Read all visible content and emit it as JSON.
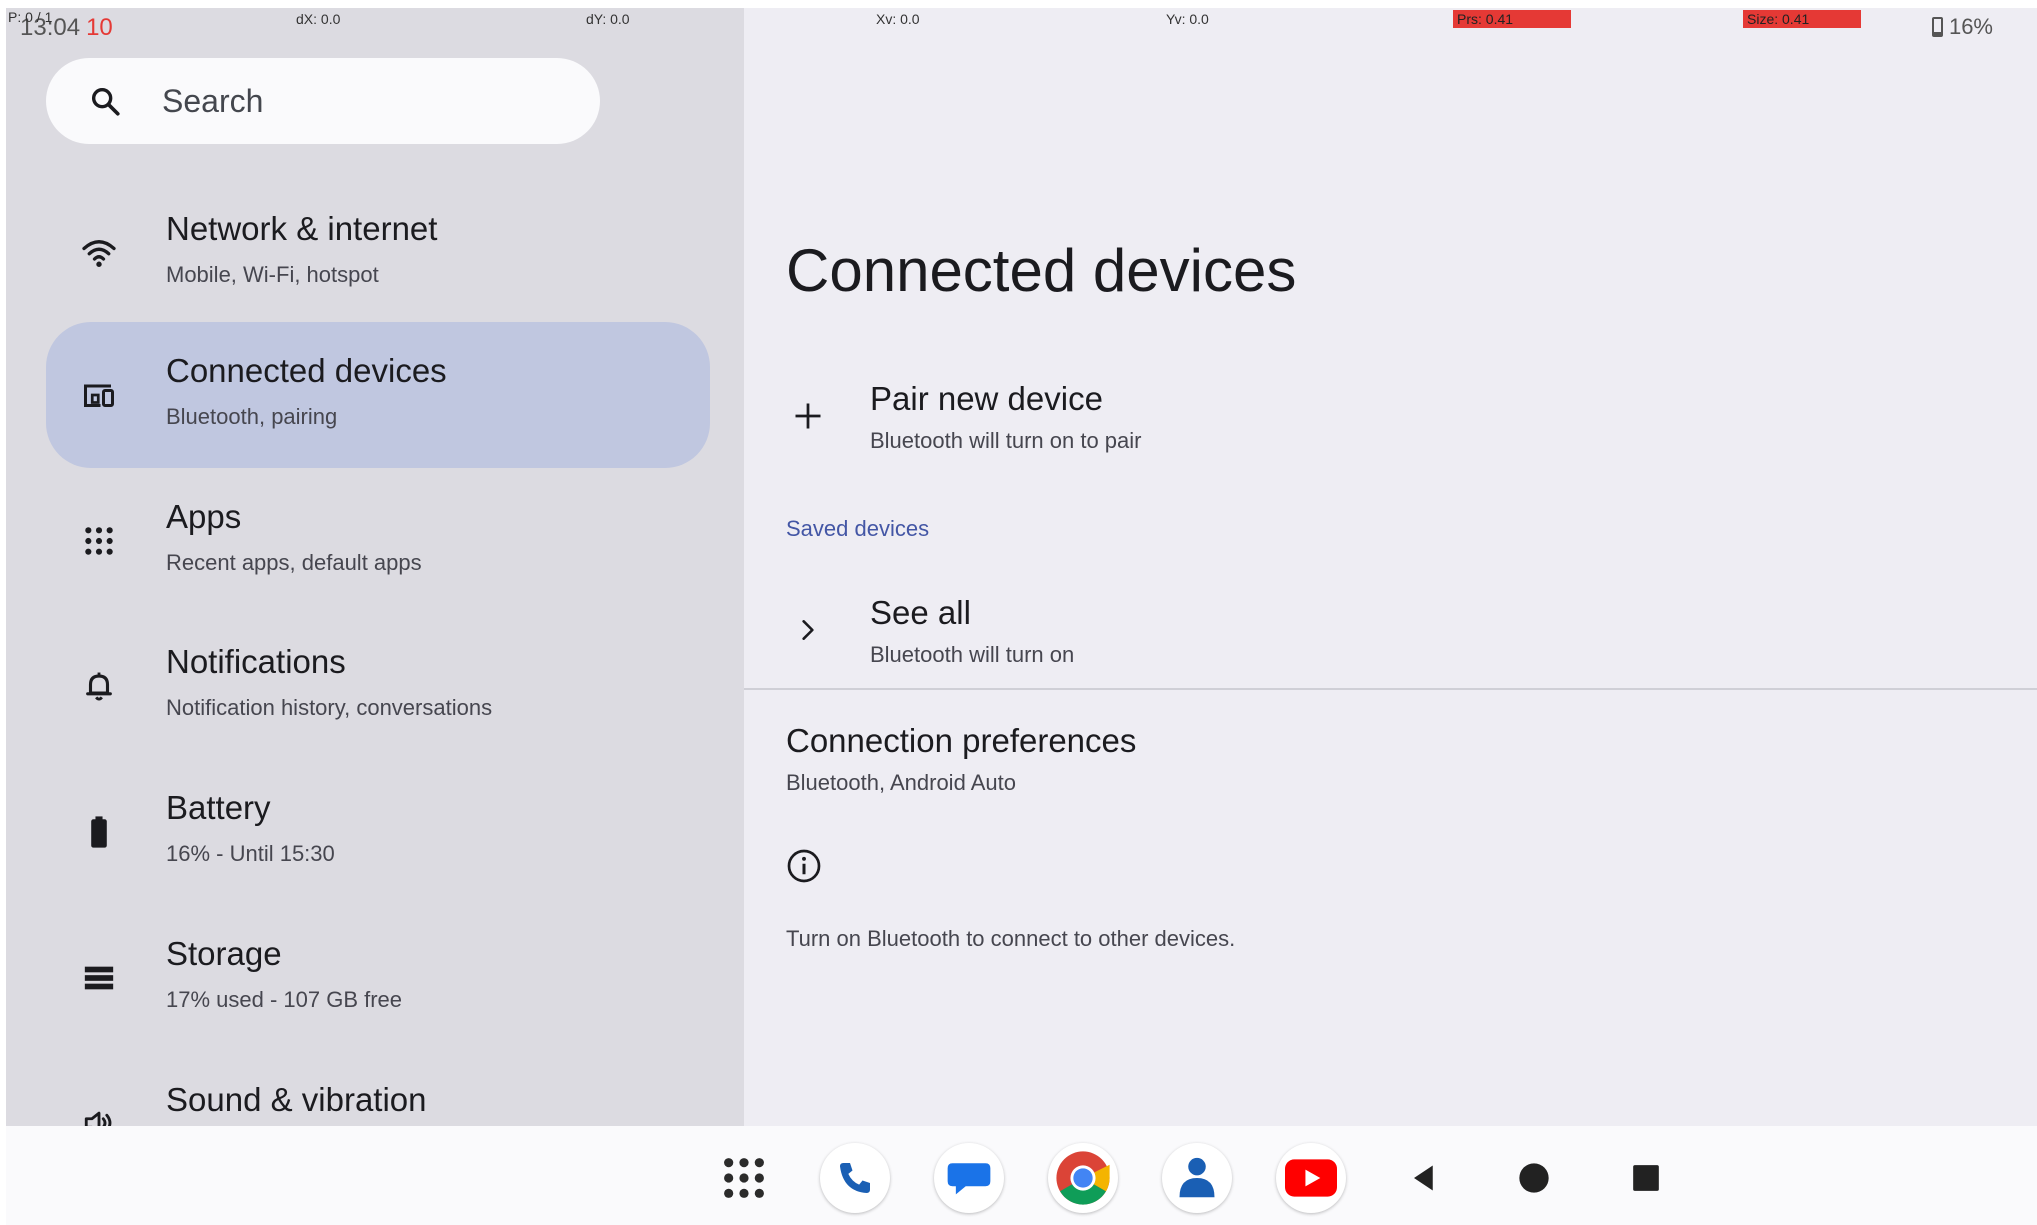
{
  "statusbar": {
    "pointer_label": "P: 0 / 1",
    "dx": "dX: 0.0",
    "dy": "dY: 0.0",
    "xv": "Xv: 0.0",
    "yv": "Yv: 0.0",
    "prs": "Prs: 0.41",
    "size": "Size: 0.41",
    "time": "13:04",
    "notif_count": "10",
    "battery": "16%"
  },
  "search": {
    "placeholder": "Search"
  },
  "sidebar": {
    "items": [
      {
        "title": "Network & internet",
        "subtitle": "Mobile, Wi-Fi, hotspot",
        "icon": "wifi-icon"
      },
      {
        "title": "Connected devices",
        "subtitle": "Bluetooth, pairing",
        "icon": "devices-icon",
        "selected": true
      },
      {
        "title": "Apps",
        "subtitle": "Recent apps, default apps",
        "icon": "apps-grid-icon"
      },
      {
        "title": "Notifications",
        "subtitle": "Notification history, conversations",
        "icon": "bell-icon"
      },
      {
        "title": "Battery",
        "subtitle": "16% - Until 15:30",
        "icon": "battery-icon"
      },
      {
        "title": "Storage",
        "subtitle": "17% used - 107 GB free",
        "icon": "storage-icon"
      },
      {
        "title": "Sound & vibration",
        "subtitle": "",
        "icon": "volume-icon"
      }
    ]
  },
  "main": {
    "title": "Connected devices",
    "pair": {
      "title": "Pair new device",
      "subtitle": "Bluetooth will turn on to pair"
    },
    "saved_label": "Saved devices",
    "see_all": {
      "title": "See all",
      "subtitle": "Bluetooth will turn on"
    },
    "prefs": {
      "title": "Connection preferences",
      "subtitle": "Bluetooth, Android Auto"
    },
    "info": "Turn on Bluetooth to connect to other devices."
  },
  "taskbar": {
    "apps": [
      "app-drawer-icon",
      "phone-icon",
      "messages-icon",
      "chrome-icon",
      "contacts-icon",
      "youtube-icon"
    ],
    "nav": [
      "back-icon",
      "home-icon",
      "recents-icon"
    ]
  },
  "colors": {
    "accent": "#4356a5",
    "selected_bg": "#c0c7e0",
    "sidebar_bg": "#dcdbe1",
    "main_bg": "#eeedf3",
    "overlay_red": "#e53935"
  }
}
